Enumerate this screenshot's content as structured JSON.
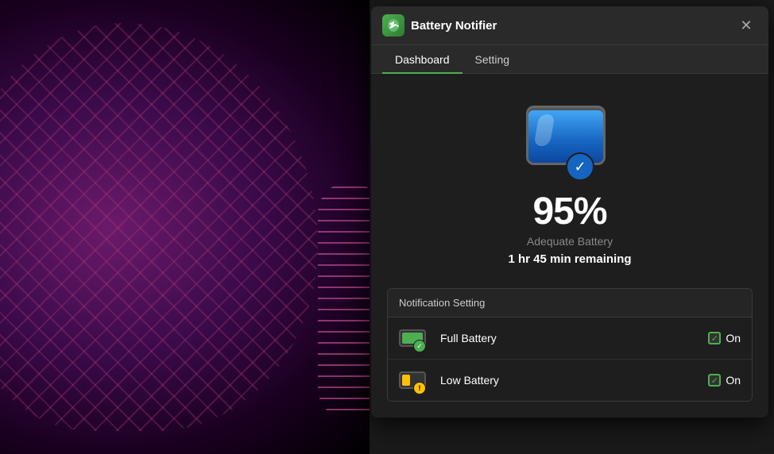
{
  "background": {
    "left_color": "#1a0020",
    "right_color": "#1a1a1a"
  },
  "window": {
    "title": "Battery Notifier",
    "close_label": "✕",
    "app_icon": "⚡",
    "tabs": [
      {
        "label": "Dashboard",
        "active": true
      },
      {
        "label": "Setting",
        "active": false
      }
    ]
  },
  "dashboard": {
    "battery_percent": "95%",
    "battery_status": "Adequate Battery",
    "battery_time": "1 hr 45 min remaining",
    "check_symbol": "✓"
  },
  "notification_section": {
    "header": "Notification Setting",
    "items": [
      {
        "label": "Full Battery",
        "toggle_label": "On",
        "checked": true,
        "check_symbol": "✓",
        "warn_symbol": "✓"
      },
      {
        "label": "Low Battery",
        "toggle_label": "On",
        "checked": true,
        "check_symbol": "✓",
        "warn_symbol": "!"
      }
    ]
  }
}
